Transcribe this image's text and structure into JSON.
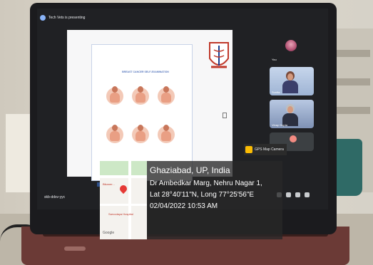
{
  "meet": {
    "presenting_label": "Tech Vets is presenting",
    "tile_you_label": "You",
    "tile_1_name": "Sunita...",
    "tile_2_name": "Vinay Gupta",
    "tile_3_name": "2 others",
    "gps_chip_label": "GPS Map Camera",
    "meeting_code": "skb-ddsv-yyc"
  },
  "slide": {
    "doc_title": "BREAST CANCER SELF-EXAMINATION"
  },
  "gps": {
    "location_title": "Ghaziabad, UP, India",
    "address": "Dr Ambedkar Marg, Nehru Nagar 1,",
    "coordinates": "Lat 28°40'11\"N, Long 77°25'56\"E",
    "datetime": "02/04/2022 10:53 AM",
    "map_brand": "Google",
    "poi_1": "Bikaner...",
    "poi_2": "Sarvodaya Hospital"
  },
  "colors": {
    "pin": "#e53935",
    "overlay_bg": "#282828"
  }
}
